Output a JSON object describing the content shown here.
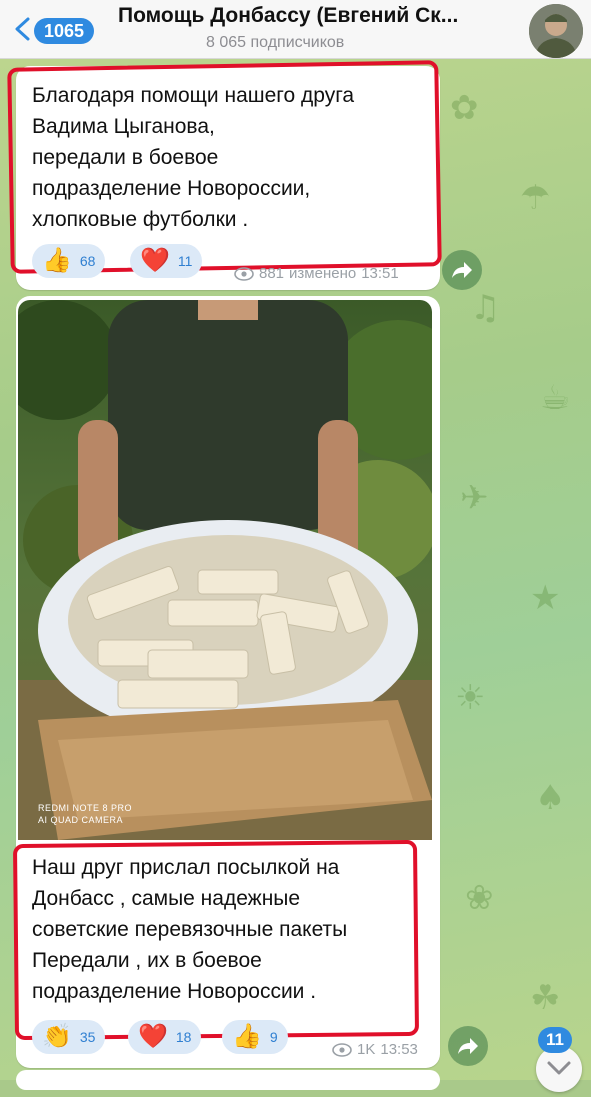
{
  "header": {
    "back_count": "1065",
    "title": "Помощь Донбассу (Евгений Ск...",
    "subtitle": "8 065 подписчиков"
  },
  "message1": {
    "text": "Благодаря помощи нашего друга\nВадима Цыганова,\nпередали в боевое\nподразделение  Новороссии,\nхлопковые футболки .",
    "reactions": [
      {
        "emoji": "👍",
        "count": "68"
      },
      {
        "emoji": "❤️",
        "count": "11"
      }
    ],
    "views": "881",
    "edited": "изменено",
    "time": "13:51"
  },
  "message2": {
    "photo_label_line1": "REDMI NOTE 8 PRO",
    "photo_label_line2": "AI QUAD CAMERA",
    "text": "Наш друг прислал посылкой на\nДонбасс , самые надежные\nсоветские перевязочные пакеты\nПередали , их в боевое\nподразделение Новороссии .",
    "reactions": [
      {
        "emoji": "👏",
        "count": "35"
      },
      {
        "emoji": "❤️",
        "count": "18"
      },
      {
        "emoji": "👍",
        "count": "9"
      }
    ],
    "views": "1K",
    "time": "13:53"
  },
  "unread_count": "11",
  "colors": {
    "accent": "#2f8ae0",
    "highlight": "#e0102a",
    "reaction_bg": "#dce9f7"
  }
}
